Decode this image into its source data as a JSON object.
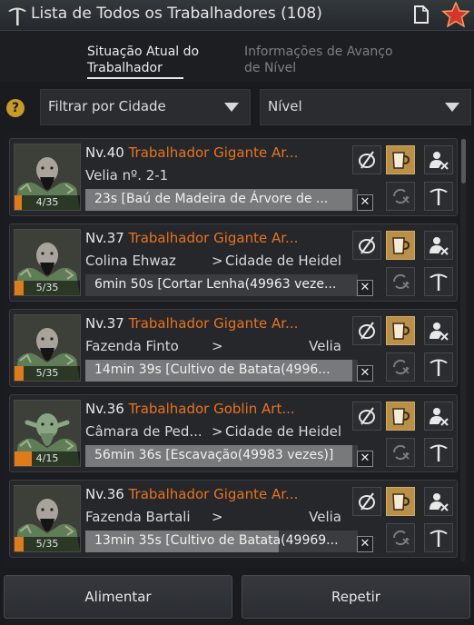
{
  "header": {
    "title": "Lista de Todos os Trabalhadores (108)"
  },
  "tabs": [
    {
      "line1": "Situação Atual do",
      "line2": "Trabalhador",
      "active": true
    },
    {
      "line1": "Informações de Avanço",
      "line2": "de Nível",
      "active": false
    }
  ],
  "filters": {
    "help": "?",
    "city": "Filtrar por Cidade",
    "level": "Nível"
  },
  "workers": [
    {
      "level": "Nv.40",
      "type": "Trabalhador Gigante Ar...",
      "from": "Velia nº. 2-1",
      "arrow": "",
      "to": "",
      "stamina": "4/35",
      "stamina_fraction": 0.114,
      "job": "23s [Baú de Madeira de Árvore de ...",
      "job_progress": 0.98,
      "portrait": "giant"
    },
    {
      "level": "Nv.37",
      "type": "Trabalhador Gigante Ar...",
      "from": "Colina Ehwaz",
      "arrow": ">",
      "to": "Cidade de Heidel",
      "stamina": "5/35",
      "stamina_fraction": 0.143,
      "job": "6min 50s [Cortar Lenha(49963 veze...",
      "job_progress": 0.0,
      "portrait": "giant"
    },
    {
      "level": "Nv.37",
      "type": "Trabalhador Gigante Ar...",
      "from": "Fazenda Finto",
      "arrow": ">",
      "to": "Velia",
      "stamina": "5/35",
      "stamina_fraction": 0.143,
      "job": "14min 39s [Cultivo de Batata(4996...",
      "job_progress": 0.98,
      "portrait": "giant"
    },
    {
      "level": "Nv.36",
      "type": "Trabalhador Goblin Art...",
      "from": "Câmara de Ped...",
      "arrow": ">",
      "to": "Cidade de Heidel",
      "stamina": "4/15",
      "stamina_fraction": 0.267,
      "job": "56min 36s [Escavação(49983 vezes)]",
      "job_progress": 0.98,
      "portrait": "goblin"
    },
    {
      "level": "Nv.36",
      "type": "Trabalhador Gigante Ar...",
      "from": "Fazenda Bartali",
      "arrow": ">",
      "to": "Velia",
      "stamina": "5/35",
      "stamina_fraction": 0.143,
      "job": "13min 35s [Cultivo de Batata(49969...",
      "job_progress": 0.71,
      "portrait": "giant"
    }
  ],
  "icons": {
    "title": "pickaxe-icon",
    "doc": "document-icon",
    "star": "favorite-star-icon",
    "card_buttons": [
      "hide-icon",
      "feed-beer-icon",
      "dismiss-worker-icon",
      "repeat-icon",
      "pickaxe-icon"
    ]
  },
  "colors": {
    "accent_orange": "#e8731e",
    "gold_button": "#b8904a",
    "star_red": "#d6352a"
  },
  "footer": {
    "feed": "Alimentar",
    "repeat": "Repetir"
  }
}
